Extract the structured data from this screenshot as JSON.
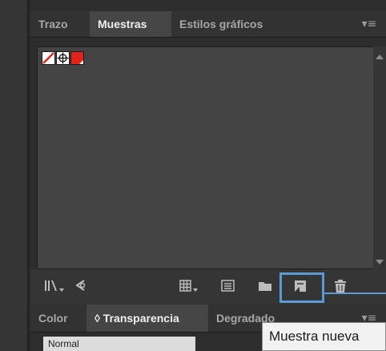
{
  "top_panel": {
    "tabs": [
      {
        "label": "Trazo",
        "active": false
      },
      {
        "label": "Muestras",
        "active": true
      },
      {
        "label": "Estilos gráficos",
        "active": false
      }
    ],
    "menu_icon": "panel-menu-icon",
    "swatches": [
      {
        "name": "none-swatch"
      },
      {
        "name": "registration-swatch"
      },
      {
        "name": "red-swatch",
        "color": "#e2231a"
      }
    ]
  },
  "toolbar": {
    "icons": [
      "swatch-libraries-menu-icon",
      "swatch-kind-menu-icon",
      "show-swatch-kinds-icon",
      "swatch-options-icon",
      "new-color-group-icon",
      "new-swatch-icon",
      "delete-swatch-icon"
    ],
    "highlight_color": "#5a9bd5"
  },
  "bottom_panel": {
    "tabs": [
      {
        "label": "Color",
        "active": false
      },
      {
        "label": "◊ Transparencia",
        "active": true
      },
      {
        "label": "Degradado",
        "active": false
      }
    ]
  },
  "tooltip": {
    "text": "Muestra nueva"
  },
  "below": {
    "header_fragment": "Normal"
  }
}
